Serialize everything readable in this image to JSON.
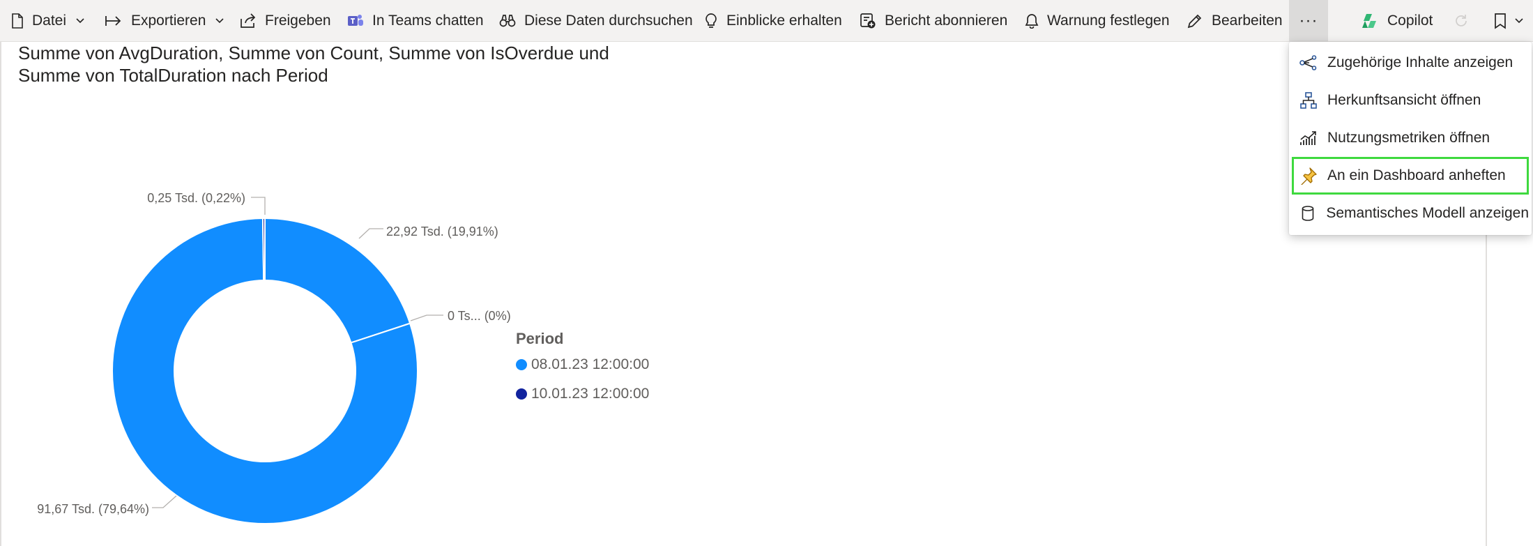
{
  "toolbar": {
    "file": "Datei",
    "export": "Exportieren",
    "share": "Freigeben",
    "teams": "In Teams chatten",
    "explore": "Diese Daten durchsuchen",
    "insights": "Einblicke erhalten",
    "subscribe": "Bericht abonnieren",
    "alert": "Warnung festlegen",
    "edit": "Bearbeiten",
    "more": "···",
    "copilot": "Copilot"
  },
  "visual": {
    "title_line1": "Summe von AvgDuration, Summe von Count, Summe von IsOverdue und",
    "title_line2": "Summe von TotalDuration nach Period"
  },
  "chart_data": {
    "type": "donut",
    "legend_title": "Period",
    "legend": [
      "08.01.23 12:00:00",
      "10.01.23 12:00:00"
    ],
    "slices": [
      {
        "label": "22,92 Tsd. (19,91%)",
        "value": 22.92,
        "percent": 19.91,
        "series": "08.01.23 12:00:00",
        "color": "#118dff"
      },
      {
        "label": "0 Ts... (0%)",
        "value": 0,
        "percent": 0,
        "series": "10.01.23 12:00:00",
        "color": "#12239e"
      },
      {
        "label": "91,67 Tsd. (79,64%)",
        "value": 91.67,
        "percent": 79.64,
        "series": "08.01.23 12:00:00",
        "color": "#118dff"
      },
      {
        "label": "0,25 Tsd. (0,22%)",
        "value": 0.25,
        "percent": 0.22,
        "series": "10.01.23 12:00:00",
        "color": "#12239e"
      }
    ]
  },
  "menu": {
    "items": [
      {
        "label": "Zugehörige Inhalte anzeigen",
        "icon": "related-content-icon"
      },
      {
        "label": "Herkunftsansicht öffnen",
        "icon": "lineage-icon"
      },
      {
        "label": "Nutzungsmetriken öffnen",
        "icon": "usage-metrics-icon"
      },
      {
        "label": "An ein Dashboard anheften",
        "icon": "pin-icon",
        "highlighted": true
      },
      {
        "label": "Semantisches Modell anzeigen",
        "icon": "semantic-model-icon"
      }
    ]
  },
  "colors": {
    "accent": "#118dff",
    "secondary_series": "#12239e",
    "highlight_outline": "#3ed93e"
  }
}
